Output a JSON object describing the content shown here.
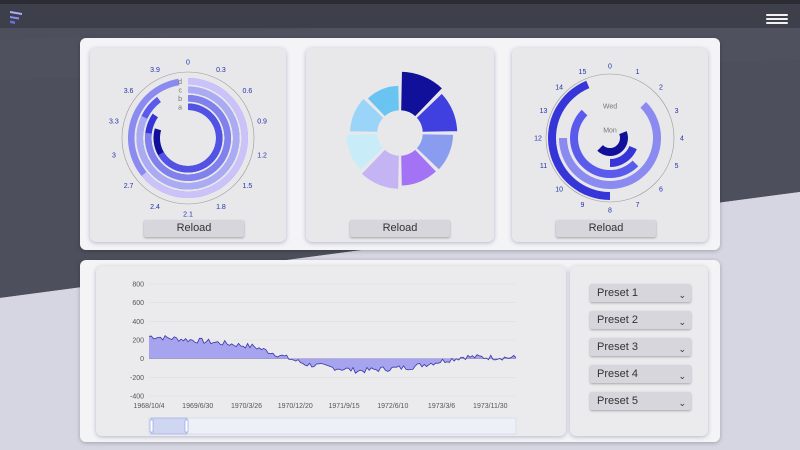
{
  "header": {
    "menu_icon": "hamburger-icon",
    "logo_icon": "app-logo-icon"
  },
  "colors": {
    "bg_dark": "#4d4f5c",
    "bg_light": "#d6d6e2",
    "palette": [
      "#10109a",
      "#3636d8",
      "#5a5aec",
      "#8a8af0",
      "#b4b4f4",
      "#d0c8f8"
    ]
  },
  "cards": [
    {
      "reload_label": "Reload"
    },
    {
      "reload_label": "Reload"
    },
    {
      "reload_label": "Reload"
    }
  ],
  "polar_bar": {
    "angle_ticks": [
      "0",
      "0.3",
      "0.6",
      "0.9",
      "1.2",
      "1.5",
      "1.8",
      "2.1",
      "2.4",
      "2.7",
      "3",
      "3.3",
      "3.6",
      "3.9"
    ],
    "radius_categories": [
      "a",
      "b",
      "c",
      "d"
    ],
    "chart_data": {
      "type": "polar-bar",
      "angle_max": 3.9,
      "series": [
        {
          "category": "a",
          "values": [
            3.1,
            2.6
          ]
        },
        {
          "category": "b",
          "values": [
            3.3,
            3.0
          ]
        },
        {
          "category": "c",
          "values": [
            3.5,
            3.2
          ]
        },
        {
          "category": "d",
          "values": [
            3.8,
            2.5
          ]
        }
      ]
    }
  },
  "rose": {
    "chart_data": {
      "type": "pie",
      "values": [
        100,
        85,
        70,
        68,
        80,
        72,
        58,
        48
      ],
      "colors": [
        "#10109a",
        "#4040e0",
        "#8a9cf0",
        "#a472f5",
        "#c4b4f4",
        "#c8ecf8",
        "#9ad4f8",
        "#6ac4f2"
      ]
    }
  },
  "polar_hours": {
    "angle_ticks": [
      "0",
      "1",
      "2",
      "3",
      "4",
      "5",
      "6",
      "7",
      "8",
      "9",
      "10",
      "11",
      "12",
      "13",
      "14",
      "15"
    ],
    "radius_labels": [
      "Mon",
      "Wed"
    ],
    "chart_data": {
      "type": "polar-bar",
      "angle_max": 16,
      "series": [
        {
          "ring": 1,
          "values": [
            3,
            10
          ]
        },
        {
          "ring": 2,
          "values": [
            5,
            8
          ]
        },
        {
          "ring": 3,
          "values": [
            6,
            14
          ]
        },
        {
          "ring": 4,
          "values": [
            2,
            12
          ]
        },
        {
          "ring": 5,
          "values": [
            8,
            15
          ]
        }
      ]
    }
  },
  "timeseries": {
    "y_ticks": [
      "800",
      "600",
      "400",
      "200",
      "0",
      "-200",
      "-400"
    ],
    "x_ticks": [
      "1968/10/4",
      "1969/6/30",
      "1970/3/26",
      "1970/12/20",
      "1971/9/15",
      "1972/6/10",
      "1973/3/6",
      "1973/11/30"
    ],
    "chart_data": {
      "type": "area",
      "ylim": [
        -400,
        800
      ],
      "x": [
        "1968/10/4",
        "1969/6/30",
        "1970/3/26",
        "1970/12/20",
        "1971/9/15",
        "1972/6/10",
        "1973/3/6",
        "1973/11/30"
      ],
      "values": [
        240,
        190,
        130,
        -60,
        -130,
        -90,
        20,
        10
      ]
    }
  },
  "presets": [
    "Preset 1",
    "Preset 2",
    "Preset 3",
    "Preset 4",
    "Preset 5"
  ]
}
